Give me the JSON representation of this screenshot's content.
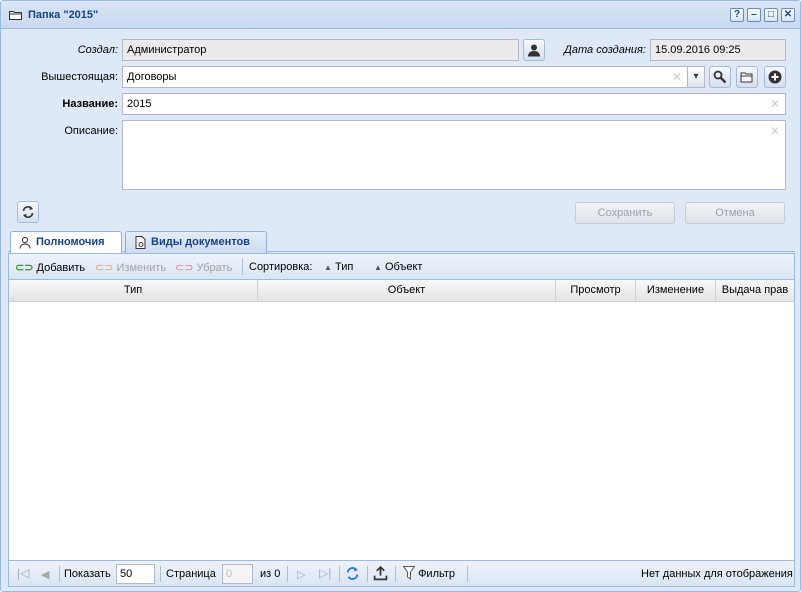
{
  "window": {
    "title": "Папка \"2015\"",
    "tools": [
      "?",
      "–",
      "□",
      "✕"
    ]
  },
  "form": {
    "created_by_label": "Создал:",
    "created_by_value": "Администратор",
    "created_date_label": "Дата создания:",
    "created_date_value": "15.09.2016 09:25",
    "parent_label": "Вышестоящая:",
    "parent_value": "Договоры",
    "name_label": "Название:",
    "name_value": "2015",
    "description_label": "Описание:",
    "description_value": "",
    "save_label": "Сохранить",
    "cancel_label": "Отмена"
  },
  "tabs": [
    {
      "label": "Полномочия",
      "active": true
    },
    {
      "label": "Виды документов",
      "active": false
    }
  ],
  "toolbar": {
    "add_label": "Добавить",
    "edit_label": "Изменить",
    "remove_label": "Убрать",
    "sort_label": "Сортировка:",
    "sort_type_label": "Тип",
    "sort_object_label": "Объект"
  },
  "grid": {
    "columns": [
      "Тип",
      "Объект",
      "Просмотр",
      "Изменение",
      "Выдача прав"
    ]
  },
  "pager": {
    "show_label": "Показать",
    "page_size": "50",
    "page_label": "Страница",
    "page_value": "0",
    "of_label": "из 0",
    "filter_label": "Фильтр",
    "empty_text": "Нет данных для отображения"
  },
  "colors": {
    "title_text": "#15428b",
    "border": "#99bbe8",
    "background": "#dfe8f6"
  }
}
